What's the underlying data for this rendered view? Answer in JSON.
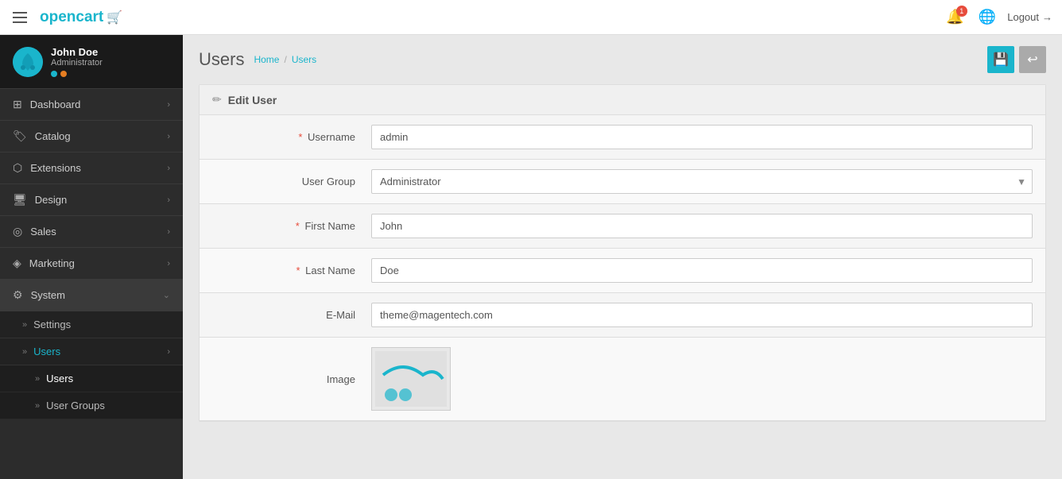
{
  "navbar": {
    "logo_text": "opencart",
    "notification_count": "1",
    "logout_label": "Logout"
  },
  "sidebar": {
    "profile": {
      "name": "John Doe",
      "role": "Administrator"
    },
    "items": [
      {
        "id": "dashboard",
        "icon": "🏠",
        "label": "Dashboard",
        "has_chevron": true
      },
      {
        "id": "catalog",
        "icon": "🏷",
        "label": "Catalog",
        "has_chevron": true
      },
      {
        "id": "extensions",
        "icon": "🔌",
        "label": "Extensions",
        "has_chevron": true
      },
      {
        "id": "design",
        "icon": "🖥",
        "label": "Design",
        "has_chevron": true
      },
      {
        "id": "sales",
        "icon": "💰",
        "label": "Sales",
        "has_chevron": true
      },
      {
        "id": "marketing",
        "icon": "📢",
        "label": "Marketing",
        "has_chevron": true
      },
      {
        "id": "system",
        "icon": "⚙",
        "label": "System",
        "has_chevron": true,
        "active": true
      }
    ],
    "system_subitems": [
      {
        "id": "settings",
        "label": "Settings"
      },
      {
        "id": "users",
        "label": "Users",
        "active": true,
        "has_chevron": true
      }
    ],
    "users_subitems": [
      {
        "id": "users-sub",
        "label": "Users",
        "active": true
      },
      {
        "id": "user-groups",
        "label": "User Groups"
      }
    ]
  },
  "content": {
    "title": "Users",
    "breadcrumb": {
      "home": "Home",
      "current": "Users"
    },
    "buttons": {
      "save": "💾",
      "back": "↩"
    }
  },
  "form": {
    "section_title": "Edit User",
    "fields": {
      "username_label": "Username",
      "username_value": "admin",
      "usergroup_label": "User Group",
      "usergroup_value": "Administrator",
      "firstname_label": "First Name",
      "firstname_value": "John",
      "lastname_label": "Last Name",
      "lastname_value": "Doe",
      "email_label": "E-Mail",
      "email_value": "theme@magentech.com",
      "image_label": "Image"
    }
  }
}
